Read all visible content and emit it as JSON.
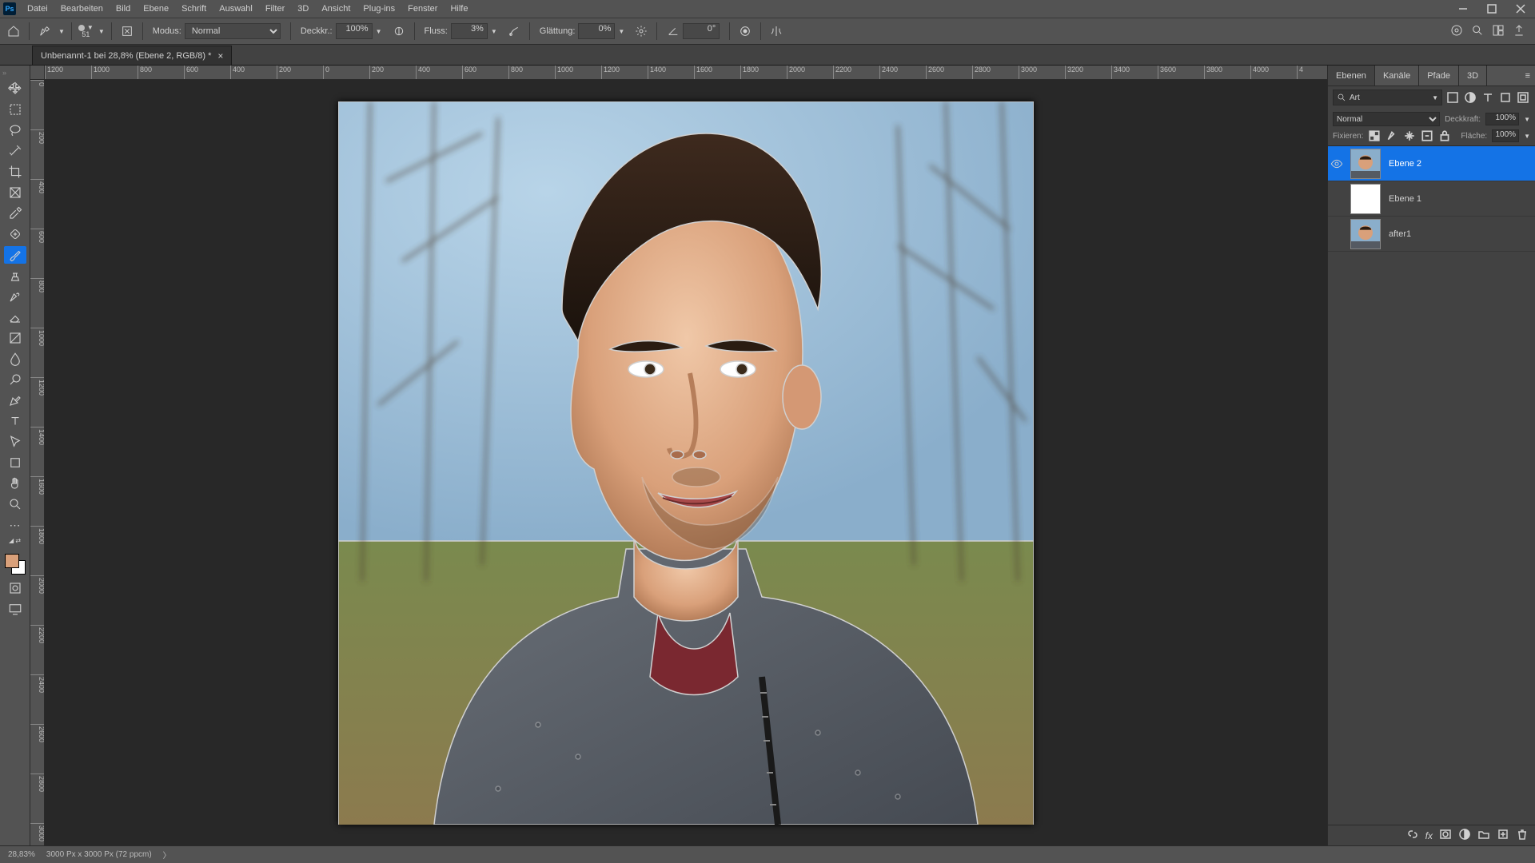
{
  "app_logo": "Ps",
  "menu": [
    "Datei",
    "Bearbeiten",
    "Bild",
    "Ebene",
    "Schrift",
    "Auswahl",
    "Filter",
    "3D",
    "Ansicht",
    "Plug-ins",
    "Fenster",
    "Hilfe"
  ],
  "options_bar": {
    "brush_size": "51",
    "mode_label": "Modus:",
    "mode_value": "Normal",
    "opacity_label": "Deckkr.:",
    "opacity_value": "100%",
    "flow_label": "Fluss:",
    "flow_value": "3%",
    "smoothing_label": "Glättung:",
    "smoothing_value": "0%",
    "angle_value": "0°"
  },
  "tab": {
    "title": "Unbenannt-1 bei 28,8% (Ebene 2, RGB/8) *"
  },
  "ruler_h": [
    "1200",
    "1000",
    "800",
    "600",
    "400",
    "200",
    "0",
    "200",
    "400",
    "600",
    "800",
    "1000",
    "1200",
    "1400",
    "1600",
    "1800",
    "2000",
    "2200",
    "2400",
    "2600",
    "2800",
    "3000",
    "3200",
    "3400",
    "3600",
    "3800",
    "4000",
    "4"
  ],
  "ruler_v": [
    "0",
    "200",
    "400",
    "600",
    "800",
    "1000",
    "1200",
    "1400",
    "1600",
    "1800",
    "2000",
    "2200",
    "2400",
    "2600",
    "2800",
    "3000"
  ],
  "swatch_fg": "#d9a07a",
  "panels": {
    "tabs": [
      "Ebenen",
      "Kanäle",
      "Pfade",
      "3D"
    ],
    "search_label": "Art",
    "blend_mode": "Normal",
    "opacity_label": "Deckkraft:",
    "opacity_value": "100%",
    "lock_label": "Fixieren:",
    "fill_label": "Fläche:",
    "fill_value": "100%"
  },
  "layers": [
    {
      "name": "Ebene 2",
      "visible": true,
      "selected": true,
      "transparent": false
    },
    {
      "name": "Ebene 1",
      "visible": false,
      "selected": false,
      "transparent": true
    },
    {
      "name": "after1",
      "visible": false,
      "selected": false,
      "transparent": false
    }
  ],
  "status": {
    "zoom": "28,83%",
    "dims": "3000 Px x 3000 Px (72 ppcm)",
    "arrow": "〉"
  }
}
